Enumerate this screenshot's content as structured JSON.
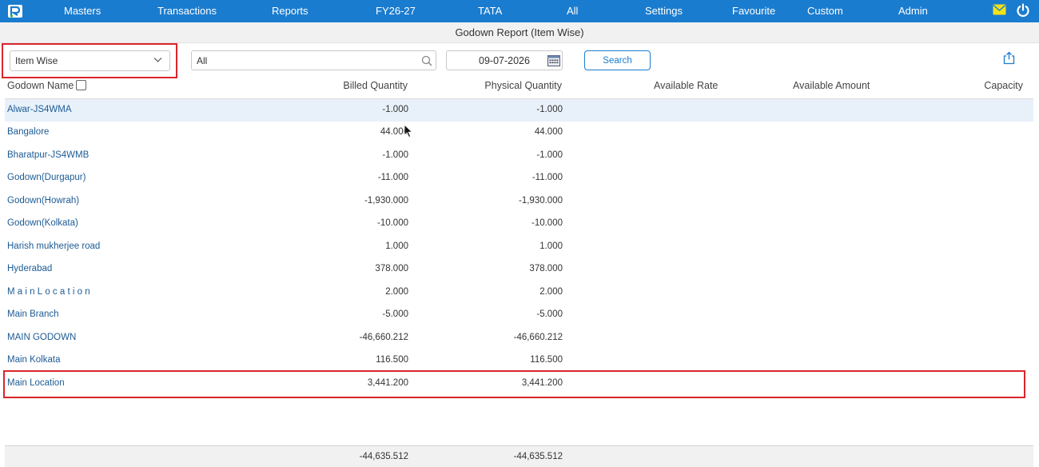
{
  "nav": {
    "items": [
      "Masters",
      "Transactions",
      "Reports",
      "FY26-27",
      "TATA",
      "All",
      "Settings",
      "Favourite",
      "Custom",
      "Admin"
    ]
  },
  "page": {
    "title": "Godown Report (Item Wise)"
  },
  "filters": {
    "report_type": "Item Wise",
    "search_value": "All",
    "date": "09-07-2026",
    "search_button": "Search"
  },
  "columns": {
    "godown_name": "Godown Name",
    "billed_quantity": "Billed Quantity",
    "physical_quantity": "Physical Quantity",
    "available_rate": "Available Rate",
    "available_amount": "Available Amount",
    "capacity": "Capacity"
  },
  "rows": [
    {
      "name": "Alwar-JS4WMA",
      "billed": "-1.000",
      "physical": "-1.000"
    },
    {
      "name": "Bangalore",
      "billed": "44.000",
      "physical": "44.000"
    },
    {
      "name": "Bharatpur-JS4WMB",
      "billed": "-1.000",
      "physical": "-1.000"
    },
    {
      "name": "Godown(Durgapur)",
      "billed": "-11.000",
      "physical": "-11.000"
    },
    {
      "name": "Godown(Howrah)",
      "billed": "-1,930.000",
      "physical": "-1,930.000"
    },
    {
      "name": "Godown(Kolkata)",
      "billed": "-10.000",
      "physical": "-10.000"
    },
    {
      "name": "Harish mukherjee road",
      "billed": "1.000",
      "physical": "1.000"
    },
    {
      "name": "Hyderabad",
      "billed": "378.000",
      "physical": "378.000"
    },
    {
      "name": "MainLocation",
      "billed": "2.000",
      "physical": "2.000"
    },
    {
      "name": "Main Branch",
      "billed": "-5.000",
      "physical": "-5.000"
    },
    {
      "name": "MAIN GODOWN",
      "billed": "-46,660.212",
      "physical": "-46,660.212"
    },
    {
      "name": "Main Kolkata",
      "billed": "116.500",
      "physical": "116.500"
    },
    {
      "name": "Main Location",
      "billed": "3,441.200",
      "physical": "3,441.200"
    }
  ],
  "totals": {
    "billed": "-44,635.512",
    "physical": "-44,635.512"
  },
  "colors": {
    "nav": "#1a7ccf",
    "link": "#1d5b94",
    "highlight_row": "#e8f1fa",
    "annotation": "#d9262b"
  }
}
